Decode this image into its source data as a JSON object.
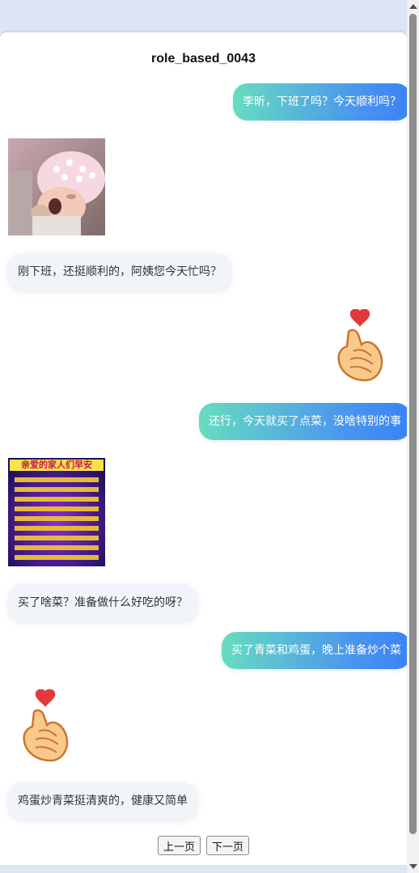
{
  "title": "role_based_0043",
  "messages": [
    {
      "side": "right",
      "type": "text",
      "text": "李昕，下班了吗？今天顺利吗？"
    },
    {
      "side": "left",
      "type": "image",
      "image": "baby-doll-photo"
    },
    {
      "side": "left",
      "type": "text",
      "text": "刚下班，还挺顺利的，阿姨您今天忙吗？"
    },
    {
      "side": "right",
      "type": "sticker",
      "icon": "finger-heart-icon"
    },
    {
      "side": "right",
      "type": "text",
      "text": "还行，今天就买了点菜，没啥特别的事"
    },
    {
      "side": "left",
      "type": "image",
      "image": "greeting-card",
      "caption": "亲爱的家人们早安"
    },
    {
      "side": "left",
      "type": "text",
      "text": "买了啥菜？准备做什么好吃的呀？"
    },
    {
      "side": "right",
      "type": "text",
      "text": "买了青菜和鸡蛋，晚上准备炒个菜"
    },
    {
      "side": "left",
      "type": "sticker",
      "icon": "finger-heart-icon"
    },
    {
      "side": "left",
      "type": "text",
      "text": "鸡蛋炒青菜挺清爽的，健康又简单"
    }
  ],
  "pager": {
    "prev_label": "上一页",
    "next_label": "下一页"
  },
  "colors": {
    "bubble_gradient_start": "#67dcc0",
    "bubble_gradient_end": "#3b82f6",
    "left_bubble": "#f1f4f9",
    "page_bg": "#dde6f3"
  }
}
